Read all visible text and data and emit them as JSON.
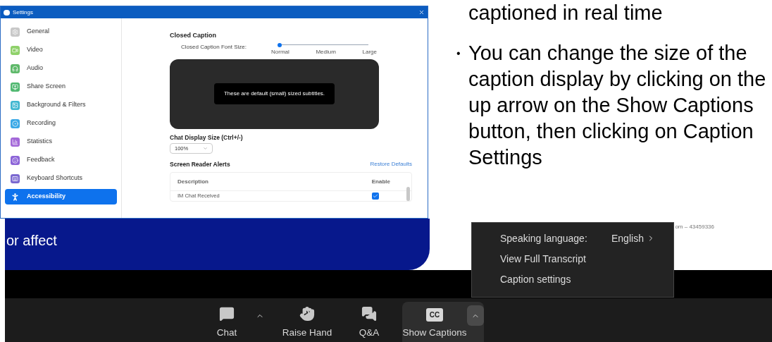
{
  "settings_window": {
    "title": "Settings",
    "sidebar": {
      "items": [
        {
          "label": "General",
          "color": "#c8c8c8",
          "selected": false
        },
        {
          "label": "Video",
          "color": "#8fd16a",
          "selected": false
        },
        {
          "label": "Audio",
          "color": "#5fb96a",
          "selected": false
        },
        {
          "label": "Share Screen",
          "color": "#4fb870",
          "selected": false
        },
        {
          "label": "Background & Filters",
          "color": "#3fb6d0",
          "selected": false
        },
        {
          "label": "Recording",
          "color": "#3aa8e6",
          "selected": false
        },
        {
          "label": "Statistics",
          "color": "#a368d8",
          "selected": false
        },
        {
          "label": "Feedback",
          "color": "#8c64d8",
          "selected": false
        },
        {
          "label": "Keyboard Shortcuts",
          "color": "#7a68d0",
          "selected": false
        },
        {
          "label": "Accessibility",
          "selected": true
        }
      ]
    },
    "closed_caption": {
      "heading": "Closed Caption",
      "font_size_label": "Closed Caption Font Size:",
      "slider": {
        "level": 0,
        "stops": [
          "Normal",
          "Medium",
          "Large"
        ]
      },
      "preview_text": "These are default (small) sized subtitles."
    },
    "chat_display": {
      "label": "Chat Display Size (Ctrl+/-)",
      "value": "100%"
    },
    "screen_reader": {
      "heading": "Screen Reader Alerts",
      "restore_link": "Restore Defaults",
      "columns": [
        "Description",
        "Enable"
      ],
      "rows": [
        {
          "description": "IM Chat Received",
          "checked": true
        }
      ]
    }
  },
  "slide_text": {
    "continuation": "captioned in real time",
    "bullet": "•",
    "bullets": [
      "You can change the size of the caption display by clicking on the up arrow on the Show Captions button, then clicking on Caption Settings"
    ]
  },
  "meeting": {
    "shared_slide_text": "or affect",
    "meeting_id_fragment": "om – 43459336",
    "caption_menu": {
      "items": [
        {
          "label": "Speaking language:",
          "value": "English",
          "submenu": true
        },
        {
          "label": "View Full Transcript",
          "submenu": false
        },
        {
          "label": "Caption settings",
          "submenu": false
        }
      ]
    },
    "toolbar": [
      {
        "label": "Chat",
        "caret": true,
        "selected": false
      },
      {
        "label": "Raise Hand",
        "caret": false,
        "selected": false
      },
      {
        "label": "Q&A",
        "caret": false,
        "selected": false
      },
      {
        "label": "Show Captions",
        "caret": true,
        "selected": true,
        "icon_text": "CC"
      }
    ]
  }
}
